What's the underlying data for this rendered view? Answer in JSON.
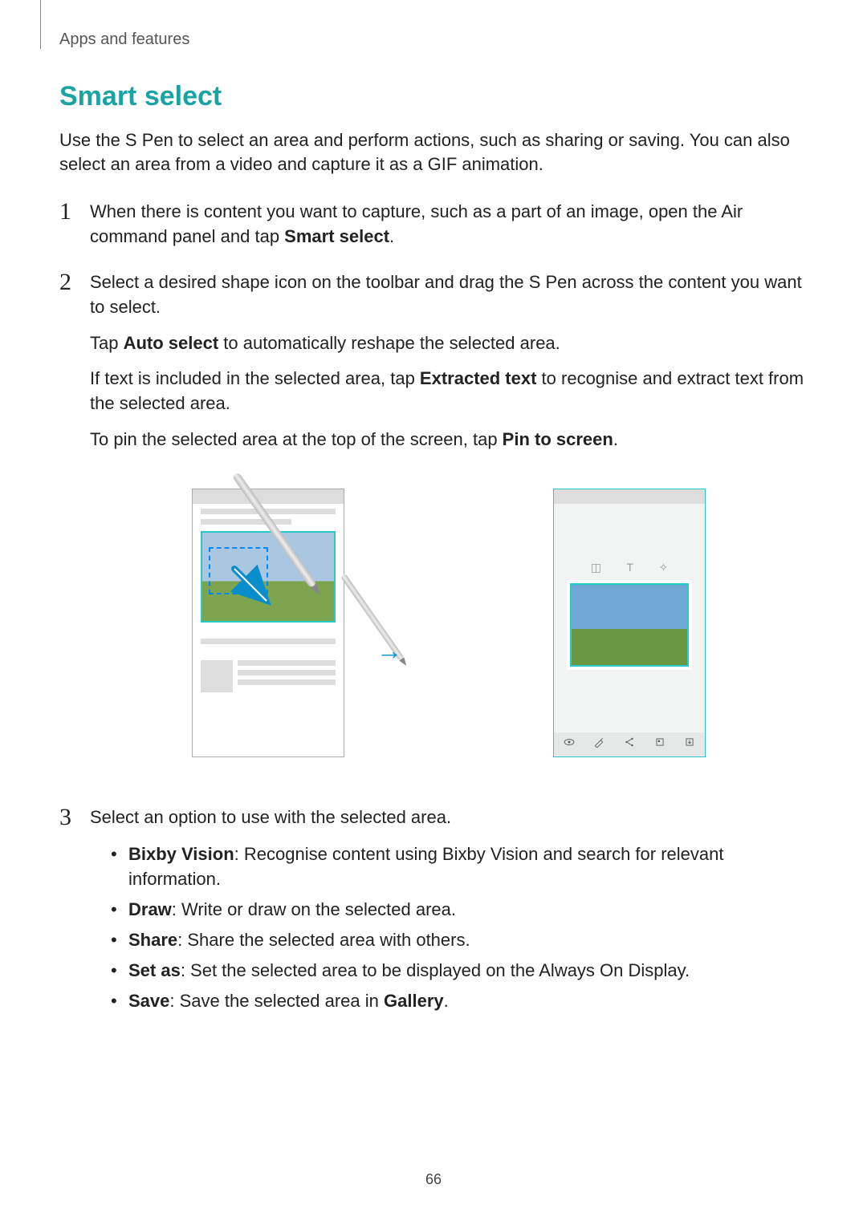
{
  "header": {
    "section": "Apps and features"
  },
  "title": "Smart select",
  "intro": "Use the S Pen to select an area and perform actions, such as sharing or saving. You can also select an area from a video and capture it as a GIF animation.",
  "steps": {
    "s1": {
      "pre": "When there is content you want to capture, such as a part of an image, open the Air command panel and tap ",
      "bold": "Smart select",
      "post": "."
    },
    "s2": {
      "p1": "Select a desired shape icon on the toolbar and drag the S Pen across the content you want to select.",
      "p2_pre": "Tap ",
      "p2_bold": "Auto select",
      "p2_post": " to automatically reshape the selected area.",
      "p3_pre": "If text is included in the selected area, tap ",
      "p3_bold": "Extracted text",
      "p3_post": " to recognise and extract text from the selected area.",
      "p4_pre": "To pin the selected area at the top of the screen, tap ",
      "p4_bold": "Pin to screen",
      "p4_post": "."
    },
    "s3": {
      "p1": "Select an option to use with the selected area.",
      "bullets": {
        "b1_bold": "Bixby Vision",
        "b1_text": ": Recognise content using Bixby Vision and search for relevant information.",
        "b2_bold": "Draw",
        "b2_text": ": Write or draw on the selected area.",
        "b3_bold": "Share",
        "b3_text": ": Share the selected area with others.",
        "b4_bold": "Set as",
        "b4_text": ": Set the selected area to be displayed on the Always On Display.",
        "b5_bold": "Save",
        "b5_text_a": ": Save the selected area in ",
        "b5_text_bold": "Gallery",
        "b5_text_b": "."
      }
    }
  },
  "page_number": "66",
  "figure": {
    "icons": {
      "eye": "bixby-vision-icon",
      "pencil": "draw-icon",
      "share": "share-icon",
      "setas": "set-as-icon",
      "save": "save-icon",
      "t": "text-icon",
      "pin": "pin-icon",
      "resize": "resize-icon"
    }
  }
}
